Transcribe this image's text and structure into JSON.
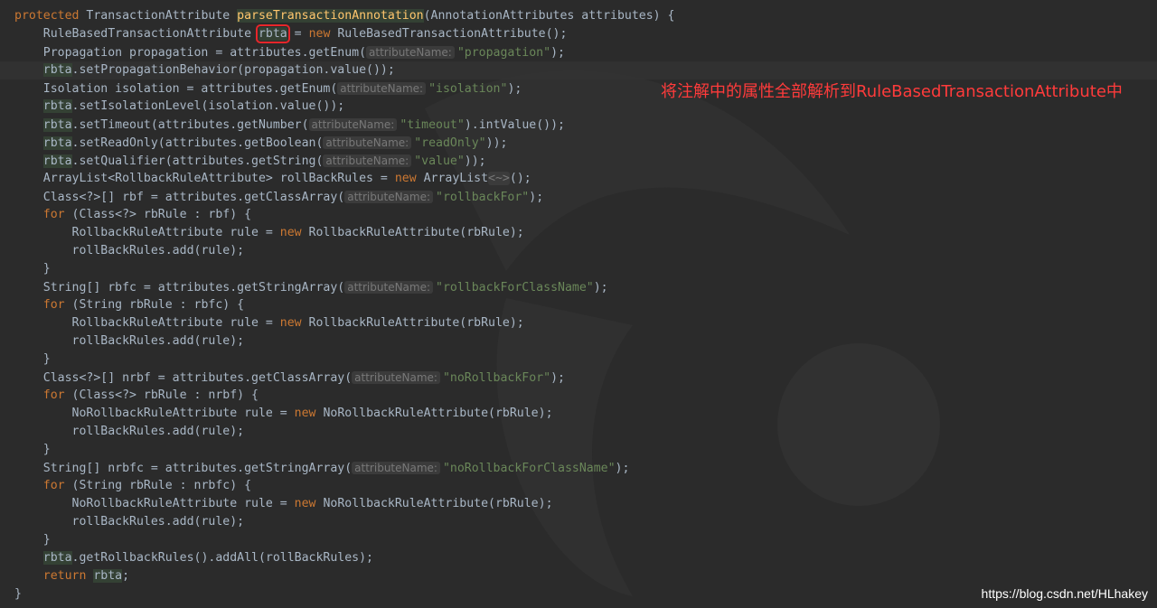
{
  "code": {
    "sig_kw": "protected",
    "sig_type": "TransactionAttribute",
    "sig_method": "parseTransactionAnnotation",
    "sig_params": "(AnnotationAttributes attributes) {",
    "l2_type": "RuleBasedTransactionAttribute",
    "l2_var": "rbta",
    "l2_eq": " = ",
    "l2_new": "new",
    "l2_rest": " RuleBasedTransactionAttribute();",
    "hint_label": "attributeName:",
    "l3_pre": "Propagation propagation = attributes.getEnum(",
    "l3_str": "\"propagation\"",
    "l3_end": ");",
    "l4_var": "rbta",
    "l4_rest": ".setPropagationBehavior(propagation.value());",
    "l5_pre": "Isolation isolation = attributes.getEnum(",
    "l5_str": "\"isolation\"",
    "l5_end": ");",
    "l6_var": "rbta",
    "l6_rest": ".setIsolationLevel(isolation.value());",
    "l7_var": "rbta",
    "l7_pre": ".setTimeout(attributes.getNumber(",
    "l7_str": "\"timeout\"",
    "l7_end": ").intValue());",
    "l8_var": "rbta",
    "l8_pre": ".setReadOnly(attributes.getBoolean(",
    "l8_str": "\"readOnly\"",
    "l8_end": "));",
    "l9_var": "rbta",
    "l9_pre": ".setQualifier(attributes.getString(",
    "l9_str": "\"value\"",
    "l9_end": "));",
    "l10_pre": "ArrayList<RollbackRuleAttribute> rollBackRules = ",
    "l10_new": "new",
    "l10_mid": " ArrayList",
    "l10_diamond": "<~>",
    "l10_end": "();",
    "l11_pre": "Class<?>[] rbf = attributes.getClassArray(",
    "l11_str": "\"rollbackFor\"",
    "l11_end": ");",
    "for_kw": "for",
    "l12_rest": " (Class<?> rbRule : rbf) {",
    "l13_pre": "RollbackRuleAttribute rule = ",
    "new_kw": "new",
    "l13_rest": " RollbackRuleAttribute(rbRule);",
    "add_rule": "rollBackRules.add(rule);",
    "close_brace": "}",
    "l16_pre": "String[] rbfc = attributes.getStringArray(",
    "l16_str": "\"rollbackForClassName\"",
    "l16_end": ");",
    "l17_rest": " (String rbRule : rbfc) {",
    "l21_pre": "Class<?>[] nrbf = attributes.getClassArray(",
    "l21_str": "\"noRollbackFor\"",
    "l21_end": ");",
    "l22_rest": " (Class<?> rbRule : nrbf) {",
    "l23_pre": "NoRollbackRuleAttribute rule = ",
    "l23_rest": " NoRollbackRuleAttribute(rbRule);",
    "l26_pre": "String[] nrbfc = attributes.getStringArray(",
    "l26_str": "\"noRollbackForClassName\"",
    "l26_end": ");",
    "l27_rest": " (String rbRule : nrbfc) {",
    "l31_var": "rbta",
    "l31_rest": ".getRollbackRules().addAll(rollBackRules);",
    "return_kw": "return",
    "l32_var": "rbta",
    "l32_end": ";"
  },
  "annotation_text": "将注解中的属性全部解析到RuleBasedTransactionAttribute中",
  "watermark": "https://blog.csdn.net/HLhakey",
  "colors": {
    "background": "#2b2b2b",
    "keyword": "#cc7832",
    "string": "#6a8759",
    "method_decl": "#ffc66d",
    "annotation": "#ff3b3b",
    "highlight_box": "#e8262a"
  }
}
